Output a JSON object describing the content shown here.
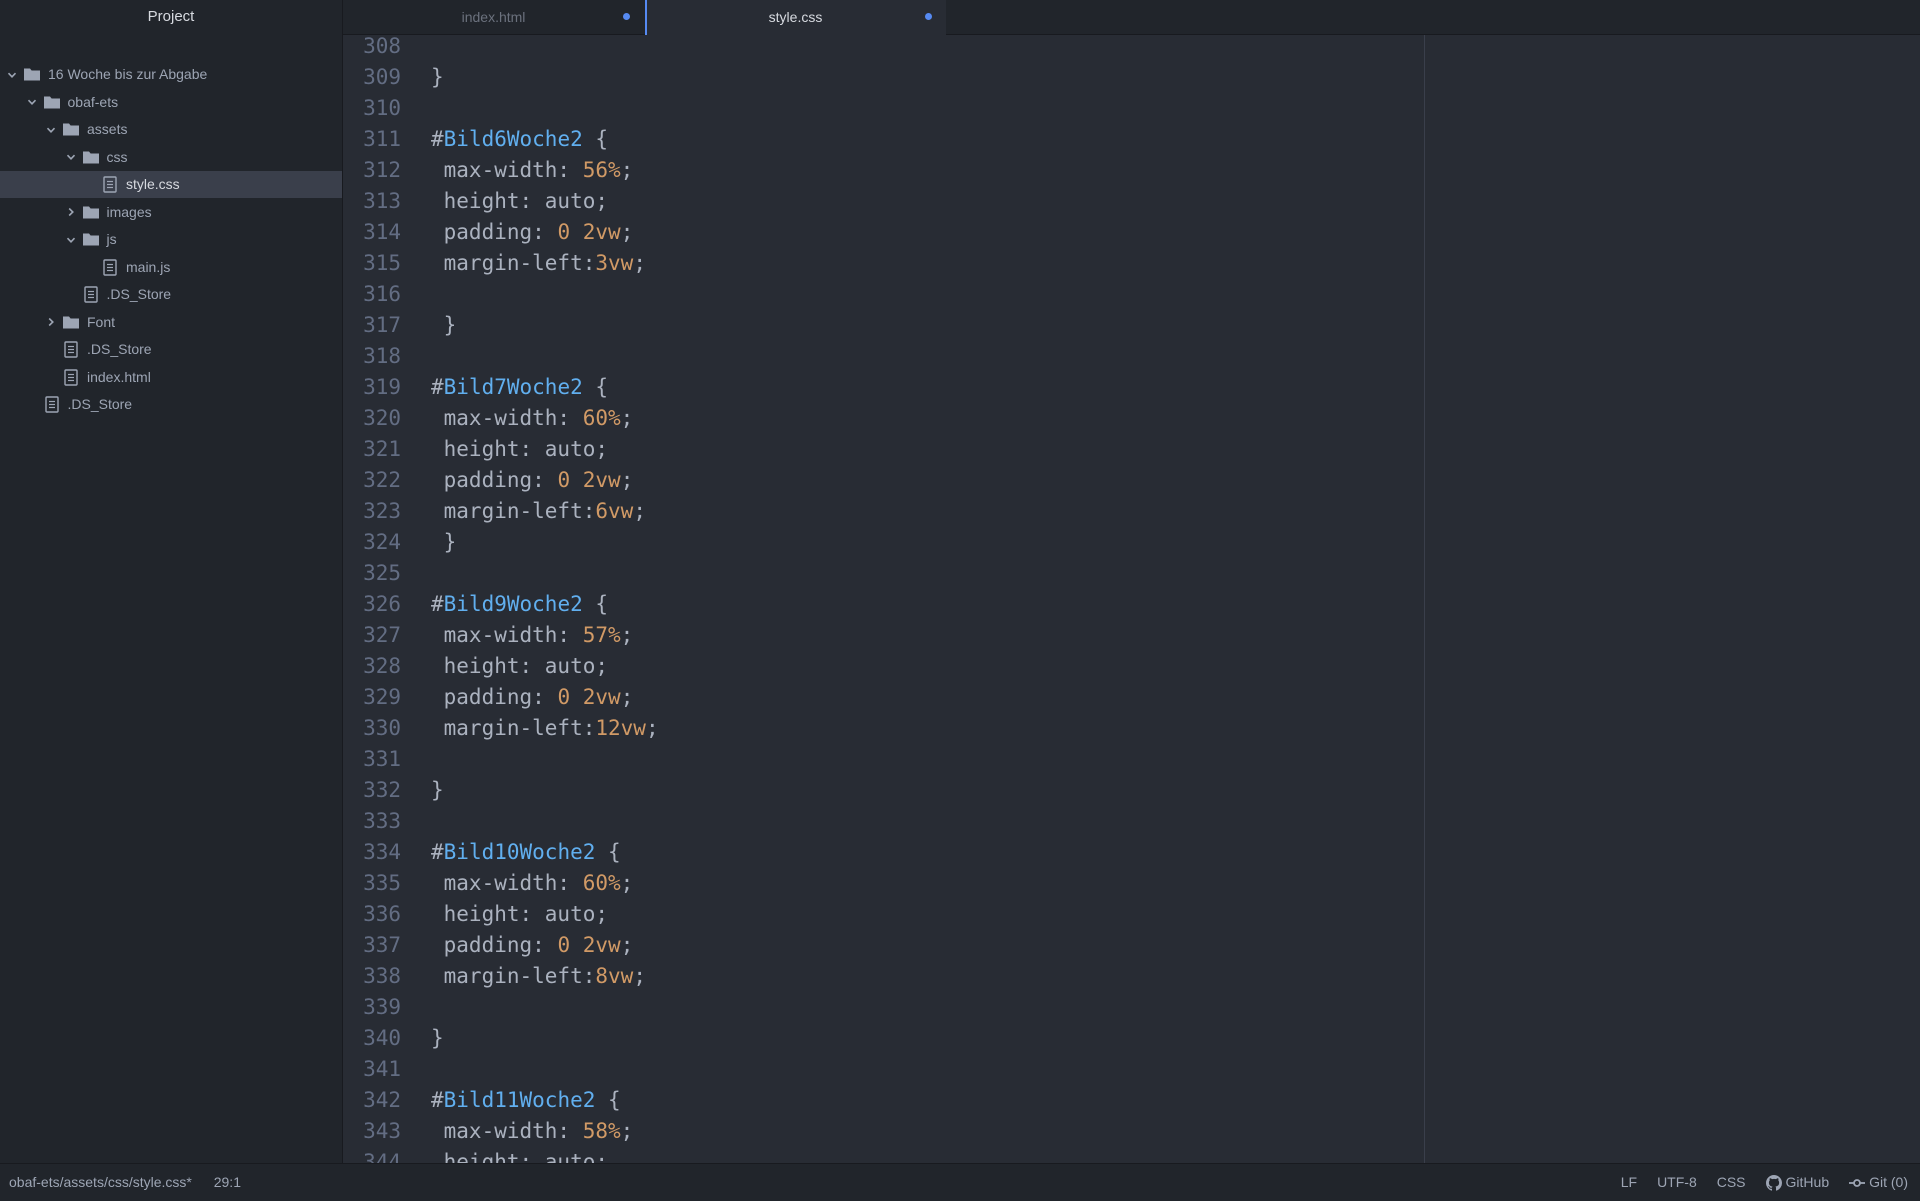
{
  "sidebar": {
    "title": "Project",
    "tree": [
      {
        "label": "16 Woche bis zur Abgabe",
        "type": "folder",
        "depth": 0,
        "chevron": "expanded"
      },
      {
        "label": "obaf-ets",
        "type": "folder",
        "depth": 1,
        "chevron": "expanded"
      },
      {
        "label": "assets",
        "type": "folder",
        "depth": 2,
        "chevron": "expanded"
      },
      {
        "label": "css",
        "type": "folder",
        "depth": 3,
        "chevron": "expanded"
      },
      {
        "label": "style.css",
        "type": "file",
        "depth": 4,
        "selected": true
      },
      {
        "label": "images",
        "type": "folder",
        "depth": 3,
        "chevron": "collapsed"
      },
      {
        "label": "js",
        "type": "folder",
        "depth": 3,
        "chevron": "expanded"
      },
      {
        "label": "main.js",
        "type": "file",
        "depth": 4
      },
      {
        "label": ".DS_Store",
        "type": "file",
        "depth": 3
      },
      {
        "label": "Font",
        "type": "folder",
        "depth": 2,
        "chevron": "collapsed"
      },
      {
        "label": ".DS_Store",
        "type": "file",
        "depth": 2
      },
      {
        "label": "index.html",
        "type": "file",
        "depth": 2
      },
      {
        "label": ".DS_Store",
        "type": "file",
        "depth": 1
      }
    ]
  },
  "tabs": [
    {
      "label": "index.html",
      "active": false,
      "modified": true
    },
    {
      "label": "style.css",
      "active": true,
      "modified": true
    }
  ],
  "editor": {
    "lines": [
      {
        "n": "308",
        "tokens": []
      },
      {
        "n": "309",
        "tokens": [
          {
            "t": "}",
            "c": "punc"
          }
        ]
      },
      {
        "n": "310",
        "tokens": []
      },
      {
        "n": "311",
        "tokens": [
          {
            "t": "#",
            "c": "hash"
          },
          {
            "t": "Bild6Woche2",
            "c": "id"
          },
          {
            "t": " {",
            "c": "punc"
          }
        ]
      },
      {
        "n": "312",
        "tokens": [
          {
            "t": " max-width: ",
            "c": "prop"
          },
          {
            "t": "56%",
            "c": "num"
          },
          {
            "t": ";",
            "c": "punc"
          }
        ]
      },
      {
        "n": "313",
        "tokens": [
          {
            "t": " height: auto;",
            "c": "plain"
          }
        ]
      },
      {
        "n": "314",
        "tokens": [
          {
            "t": " padding: ",
            "c": "prop"
          },
          {
            "t": "0",
            "c": "num"
          },
          {
            "t": " ",
            "c": "plain"
          },
          {
            "t": "2vw",
            "c": "num"
          },
          {
            "t": ";",
            "c": "punc"
          }
        ]
      },
      {
        "n": "315",
        "tokens": [
          {
            "t": " margin-left:",
            "c": "prop"
          },
          {
            "t": "3vw",
            "c": "num"
          },
          {
            "t": ";",
            "c": "punc"
          }
        ]
      },
      {
        "n": "316",
        "tokens": []
      },
      {
        "n": "317",
        "tokens": [
          {
            "t": " }",
            "c": "punc"
          }
        ]
      },
      {
        "n": "318",
        "tokens": []
      },
      {
        "n": "319",
        "tokens": [
          {
            "t": "#",
            "c": "hash"
          },
          {
            "t": "Bild7Woche2",
            "c": "id"
          },
          {
            "t": " {",
            "c": "punc"
          }
        ]
      },
      {
        "n": "320",
        "tokens": [
          {
            "t": " max-width: ",
            "c": "prop"
          },
          {
            "t": "60%",
            "c": "num"
          },
          {
            "t": ";",
            "c": "punc"
          }
        ]
      },
      {
        "n": "321",
        "tokens": [
          {
            "t": " height: auto;",
            "c": "plain"
          }
        ]
      },
      {
        "n": "322",
        "tokens": [
          {
            "t": " padding: ",
            "c": "prop"
          },
          {
            "t": "0",
            "c": "num"
          },
          {
            "t": " ",
            "c": "plain"
          },
          {
            "t": "2vw",
            "c": "num"
          },
          {
            "t": ";",
            "c": "punc"
          }
        ]
      },
      {
        "n": "323",
        "tokens": [
          {
            "t": " margin-left:",
            "c": "prop"
          },
          {
            "t": "6vw",
            "c": "num"
          },
          {
            "t": ";",
            "c": "punc"
          }
        ]
      },
      {
        "n": "324",
        "tokens": [
          {
            "t": " }",
            "c": "punc"
          }
        ]
      },
      {
        "n": "325",
        "tokens": []
      },
      {
        "n": "326",
        "tokens": [
          {
            "t": "#",
            "c": "hash"
          },
          {
            "t": "Bild9Woche2",
            "c": "id"
          },
          {
            "t": " {",
            "c": "punc"
          }
        ]
      },
      {
        "n": "327",
        "tokens": [
          {
            "t": " max-width: ",
            "c": "prop"
          },
          {
            "t": "57%",
            "c": "num"
          },
          {
            "t": ";",
            "c": "punc"
          }
        ]
      },
      {
        "n": "328",
        "tokens": [
          {
            "t": " height: auto;",
            "c": "plain"
          }
        ]
      },
      {
        "n": "329",
        "tokens": [
          {
            "t": " padding: ",
            "c": "prop"
          },
          {
            "t": "0",
            "c": "num"
          },
          {
            "t": " ",
            "c": "plain"
          },
          {
            "t": "2vw",
            "c": "num"
          },
          {
            "t": ";",
            "c": "punc"
          }
        ]
      },
      {
        "n": "330",
        "tokens": [
          {
            "t": " margin-left:",
            "c": "prop"
          },
          {
            "t": "12vw",
            "c": "num"
          },
          {
            "t": ";",
            "c": "punc"
          }
        ]
      },
      {
        "n": "331",
        "tokens": []
      },
      {
        "n": "332",
        "tokens": [
          {
            "t": "}",
            "c": "punc"
          }
        ]
      },
      {
        "n": "333",
        "tokens": []
      },
      {
        "n": "334",
        "tokens": [
          {
            "t": "#",
            "c": "hash"
          },
          {
            "t": "Bild10Woche2",
            "c": "id"
          },
          {
            "t": " {",
            "c": "punc"
          }
        ]
      },
      {
        "n": "335",
        "tokens": [
          {
            "t": " max-width: ",
            "c": "prop"
          },
          {
            "t": "60%",
            "c": "num"
          },
          {
            "t": ";",
            "c": "punc"
          }
        ]
      },
      {
        "n": "336",
        "tokens": [
          {
            "t": " height: auto;",
            "c": "plain"
          }
        ]
      },
      {
        "n": "337",
        "tokens": [
          {
            "t": " padding: ",
            "c": "prop"
          },
          {
            "t": "0",
            "c": "num"
          },
          {
            "t": " ",
            "c": "plain"
          },
          {
            "t": "2vw",
            "c": "num"
          },
          {
            "t": ";",
            "c": "punc"
          }
        ]
      },
      {
        "n": "338",
        "tokens": [
          {
            "t": " margin-left:",
            "c": "prop"
          },
          {
            "t": "8vw",
            "c": "num"
          },
          {
            "t": ";",
            "c": "punc"
          }
        ]
      },
      {
        "n": "339",
        "tokens": []
      },
      {
        "n": "340",
        "tokens": [
          {
            "t": "}",
            "c": "punc"
          }
        ]
      },
      {
        "n": "341",
        "tokens": []
      },
      {
        "n": "342",
        "tokens": [
          {
            "t": "#",
            "c": "hash"
          },
          {
            "t": "Bild11Woche2",
            "c": "id"
          },
          {
            "t": " {",
            "c": "punc"
          }
        ]
      },
      {
        "n": "343",
        "tokens": [
          {
            "t": " max-width: ",
            "c": "prop"
          },
          {
            "t": "58%",
            "c": "num"
          },
          {
            "t": ";",
            "c": "punc"
          }
        ]
      },
      {
        "n": "344",
        "tokens": [
          {
            "t": " height: auto;",
            "c": "plain"
          }
        ]
      }
    ]
  },
  "statusbar": {
    "file_path": "obaf-ets/assets/css/style.css*",
    "cursor": "29:1",
    "line_ending": "LF",
    "encoding": "UTF-8",
    "grammar": "CSS",
    "github": "GitHub",
    "git": "Git (0)"
  },
  "colors": {
    "accent": "#568af2",
    "selector_id": "#61afef",
    "number": "#d19a66"
  }
}
